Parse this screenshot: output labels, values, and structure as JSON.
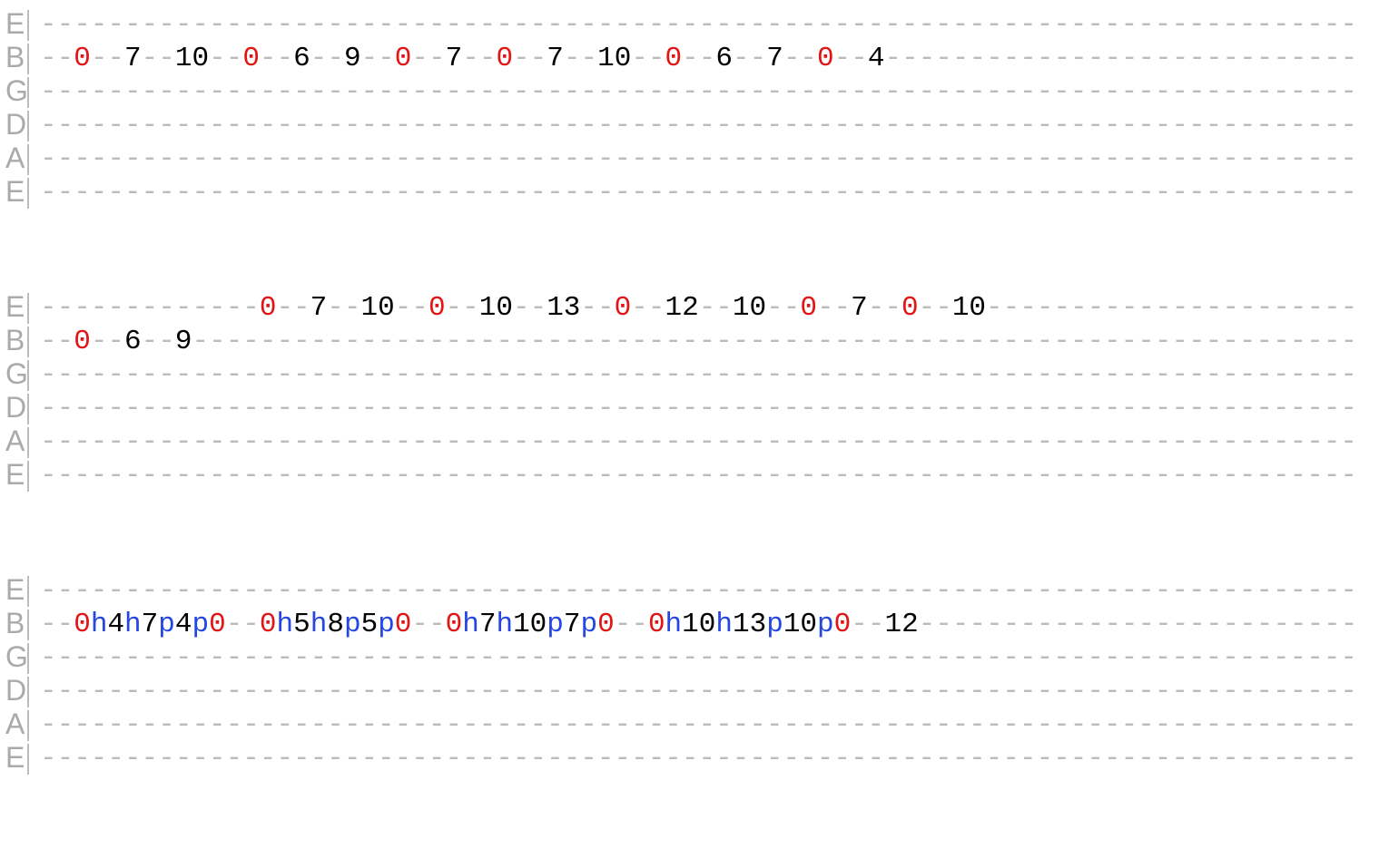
{
  "string_labels": [
    "E",
    "B",
    "G",
    "D",
    "A",
    "E"
  ],
  "dash_run": 78,
  "blocks": [
    {
      "strings": [
        {
          "label_idx": 0,
          "tokens": []
        },
        {
          "label_idx": 1,
          "tokens": [
            {
              "t": "dashes",
              "n": 2
            },
            {
              "t": "r",
              "v": "0"
            },
            {
              "t": "dashes",
              "n": 2
            },
            {
              "t": "k",
              "v": "7"
            },
            {
              "t": "dashes",
              "n": 2
            },
            {
              "t": "k",
              "v": "10"
            },
            {
              "t": "dashes",
              "n": 2
            },
            {
              "t": "r",
              "v": "0"
            },
            {
              "t": "dashes",
              "n": 2
            },
            {
              "t": "k",
              "v": "6"
            },
            {
              "t": "dashes",
              "n": 2
            },
            {
              "t": "k",
              "v": "9"
            },
            {
              "t": "dashes",
              "n": 2
            },
            {
              "t": "r",
              "v": "0"
            },
            {
              "t": "dashes",
              "n": 2
            },
            {
              "t": "k",
              "v": "7"
            },
            {
              "t": "dashes",
              "n": 2
            },
            {
              "t": "r",
              "v": "0"
            },
            {
              "t": "dashes",
              "n": 2
            },
            {
              "t": "k",
              "v": "7"
            },
            {
              "t": "dashes",
              "n": 2
            },
            {
              "t": "k",
              "v": "10"
            },
            {
              "t": "dashes",
              "n": 2
            },
            {
              "t": "r",
              "v": "0"
            },
            {
              "t": "dashes",
              "n": 2
            },
            {
              "t": "k",
              "v": "6"
            },
            {
              "t": "dashes",
              "n": 2
            },
            {
              "t": "k",
              "v": "7"
            },
            {
              "t": "dashes",
              "n": 2
            },
            {
              "t": "r",
              "v": "0"
            },
            {
              "t": "dashes",
              "n": 2
            },
            {
              "t": "k",
              "v": "4"
            },
            {
              "t": "dashes",
              "n": 2
            }
          ]
        },
        {
          "label_idx": 2,
          "tokens": []
        },
        {
          "label_idx": 3,
          "tokens": []
        },
        {
          "label_idx": 4,
          "tokens": []
        },
        {
          "label_idx": 5,
          "tokens": []
        }
      ]
    },
    {
      "strings": [
        {
          "label_idx": 0,
          "tokens": [
            {
              "t": "dashes",
              "n": 13
            },
            {
              "t": "r",
              "v": "0"
            },
            {
              "t": "dashes",
              "n": 2
            },
            {
              "t": "k",
              "v": "7"
            },
            {
              "t": "dashes",
              "n": 2
            },
            {
              "t": "k",
              "v": "10"
            },
            {
              "t": "dashes",
              "n": 2
            },
            {
              "t": "r",
              "v": "0"
            },
            {
              "t": "dashes",
              "n": 2
            },
            {
              "t": "k",
              "v": "10"
            },
            {
              "t": "dashes",
              "n": 2
            },
            {
              "t": "k",
              "v": "13"
            },
            {
              "t": "dashes",
              "n": 2
            },
            {
              "t": "r",
              "v": "0"
            },
            {
              "t": "dashes",
              "n": 2
            },
            {
              "t": "k",
              "v": "12"
            },
            {
              "t": "dashes",
              "n": 2
            },
            {
              "t": "k",
              "v": "10"
            },
            {
              "t": "dashes",
              "n": 2
            },
            {
              "t": "r",
              "v": "0"
            },
            {
              "t": "dashes",
              "n": 2
            },
            {
              "t": "k",
              "v": "7"
            },
            {
              "t": "dashes",
              "n": 2
            },
            {
              "t": "r",
              "v": "0"
            },
            {
              "t": "dashes",
              "n": 2
            },
            {
              "t": "k",
              "v": "10"
            },
            {
              "t": "dashes",
              "n": 2
            }
          ]
        },
        {
          "label_idx": 1,
          "tokens": [
            {
              "t": "dashes",
              "n": 2
            },
            {
              "t": "r",
              "v": "0"
            },
            {
              "t": "dashes",
              "n": 2
            },
            {
              "t": "k",
              "v": "6"
            },
            {
              "t": "dashes",
              "n": 2
            },
            {
              "t": "k",
              "v": "9"
            }
          ]
        },
        {
          "label_idx": 2,
          "tokens": []
        },
        {
          "label_idx": 3,
          "tokens": []
        },
        {
          "label_idx": 4,
          "tokens": []
        },
        {
          "label_idx": 5,
          "tokens": []
        }
      ]
    },
    {
      "strings": [
        {
          "label_idx": 0,
          "tokens": []
        },
        {
          "label_idx": 1,
          "tokens": [
            {
              "t": "dashes",
              "n": 2
            },
            {
              "t": "r",
              "v": "0"
            },
            {
              "t": "b",
              "v": "h"
            },
            {
              "t": "k",
              "v": "4"
            },
            {
              "t": "b",
              "v": "h"
            },
            {
              "t": "k",
              "v": "7"
            },
            {
              "t": "b",
              "v": "p"
            },
            {
              "t": "k",
              "v": "4"
            },
            {
              "t": "b",
              "v": "p"
            },
            {
              "t": "r",
              "v": "0"
            },
            {
              "t": "dashes",
              "n": 2
            },
            {
              "t": "r",
              "v": "0"
            },
            {
              "t": "b",
              "v": "h"
            },
            {
              "t": "k",
              "v": "5"
            },
            {
              "t": "b",
              "v": "h"
            },
            {
              "t": "k",
              "v": "8"
            },
            {
              "t": "b",
              "v": "p"
            },
            {
              "t": "k",
              "v": "5"
            },
            {
              "t": "b",
              "v": "p"
            },
            {
              "t": "r",
              "v": "0"
            },
            {
              "t": "dashes",
              "n": 2
            },
            {
              "t": "r",
              "v": "0"
            },
            {
              "t": "b",
              "v": "h"
            },
            {
              "t": "k",
              "v": "7"
            },
            {
              "t": "b",
              "v": "h"
            },
            {
              "t": "k",
              "v": "10"
            },
            {
              "t": "b",
              "v": "p"
            },
            {
              "t": "k",
              "v": "7"
            },
            {
              "t": "b",
              "v": "p"
            },
            {
              "t": "r",
              "v": "0"
            },
            {
              "t": "dashes",
              "n": 2
            },
            {
              "t": "r",
              "v": "0"
            },
            {
              "t": "b",
              "v": "h"
            },
            {
              "t": "k",
              "v": "10"
            },
            {
              "t": "b",
              "v": "h"
            },
            {
              "t": "k",
              "v": "13"
            },
            {
              "t": "b",
              "v": "p"
            },
            {
              "t": "k",
              "v": "10"
            },
            {
              "t": "b",
              "v": "p"
            },
            {
              "t": "r",
              "v": "0"
            },
            {
              "t": "dashes",
              "n": 2
            },
            {
              "t": "k",
              "v": "12"
            },
            {
              "t": "dashes",
              "n": 2
            }
          ]
        },
        {
          "label_idx": 2,
          "tokens": []
        },
        {
          "label_idx": 3,
          "tokens": []
        },
        {
          "label_idx": 4,
          "tokens": []
        },
        {
          "label_idx": 5,
          "tokens": []
        }
      ]
    }
  ]
}
